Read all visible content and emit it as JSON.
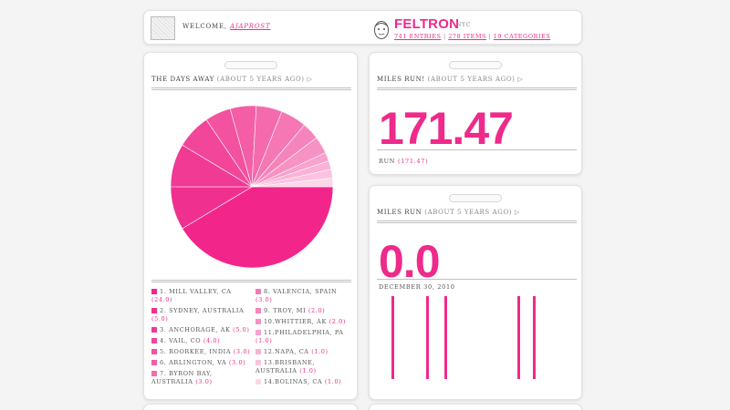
{
  "header": {
    "welcome_label": "WELCOME,",
    "username": "AJAPROST",
    "brand": "FELTRON",
    "brand_city": "NYC",
    "entries_link": "741 ENTRIES",
    "items_link": "278 ITEMS",
    "categories_link": "19 CATEGORIES",
    "separator": " | "
  },
  "days_card": {
    "title": "THE DAYS AWAY",
    "tag": " (ABOUT 5 YEARS AGO) ▷",
    "legend_left": [
      {
        "label": "1. MILL VALLEY, CA",
        "count": "(24.0)"
      },
      {
        "label": "2. SYDNEY, AUSTRALIA",
        "count": "(5.0)"
      },
      {
        "label": "3. ANCHORAGE, AK",
        "count": "(5.0)"
      },
      {
        "label": "4. VAIL, CO",
        "count": "(4.0)"
      },
      {
        "label": "5. ROORKEE, INDIA",
        "count": "(3.0)"
      },
      {
        "label": "6. ARLINGTON, VA",
        "count": "(3.0)"
      },
      {
        "label": "7. BYRON BAY, AUSTRALIA",
        "count": "(3.0)"
      }
    ],
    "legend_right": [
      {
        "label": "8. VALENCIA, SPAIN",
        "count": "(3.0)"
      },
      {
        "label": "9. TROY, MI",
        "count": "(2.0)"
      },
      {
        "label": "10.WHITTIER, AK",
        "count": "(2.0)"
      },
      {
        "label": "11.PHILADELPHIA, PA",
        "count": "(1.0)"
      },
      {
        "label": "12.NAPA, CA",
        "count": "(1.0)"
      },
      {
        "label": "13.BRISBANE, AUSTRALIA",
        "count": "(1.0)"
      },
      {
        "label": "14.BOLINAS, CA",
        "count": "(1.0)"
      }
    ]
  },
  "chart_data": {
    "type": "pie",
    "title": "THE DAYS AWAY",
    "categories": [
      "MILL VALLEY, CA",
      "SYDNEY, AUSTRALIA",
      "ANCHORAGE, AK",
      "VAIL, CO",
      "ROORKEE, INDIA",
      "ARLINGTON, VA",
      "BYRON BAY, AUSTRALIA",
      "VALENCIA, SPAIN",
      "TROY, MI",
      "WHITTIER, AK",
      "PHILADELPHIA, PA",
      "NAPA, CA",
      "BRISBANE, AUSTRALIA",
      "BOLINAS, CA"
    ],
    "values": [
      24,
      5,
      5,
      4,
      3,
      3,
      3,
      3,
      2,
      2,
      1,
      1,
      1,
      1
    ],
    "colors": [
      "#f2268a",
      "#f0308f",
      "#f03a94",
      "#f14699",
      "#f2529f",
      "#f35ea6",
      "#f46aad",
      "#f577b4",
      "#f684bc",
      "#f792c4",
      "#f8a2cd",
      "#fab2d6",
      "#fbc3df",
      "#fcd6e9"
    ]
  },
  "miles_card": {
    "title": "MILES RUN!",
    "tag": " (ABOUT 5 YEARS AGO) ▷",
    "value": "171.47",
    "sub_label": "RUN",
    "sub_value": "(171.47)"
  },
  "run_card": {
    "title": "MILES RUN",
    "tag": " (ABOUT 5 YEARS AGO) ▷",
    "value": "0.0",
    "date": "DECEMBER 30, 2010"
  },
  "colors": {
    "accent": "#ee2a8a"
  }
}
